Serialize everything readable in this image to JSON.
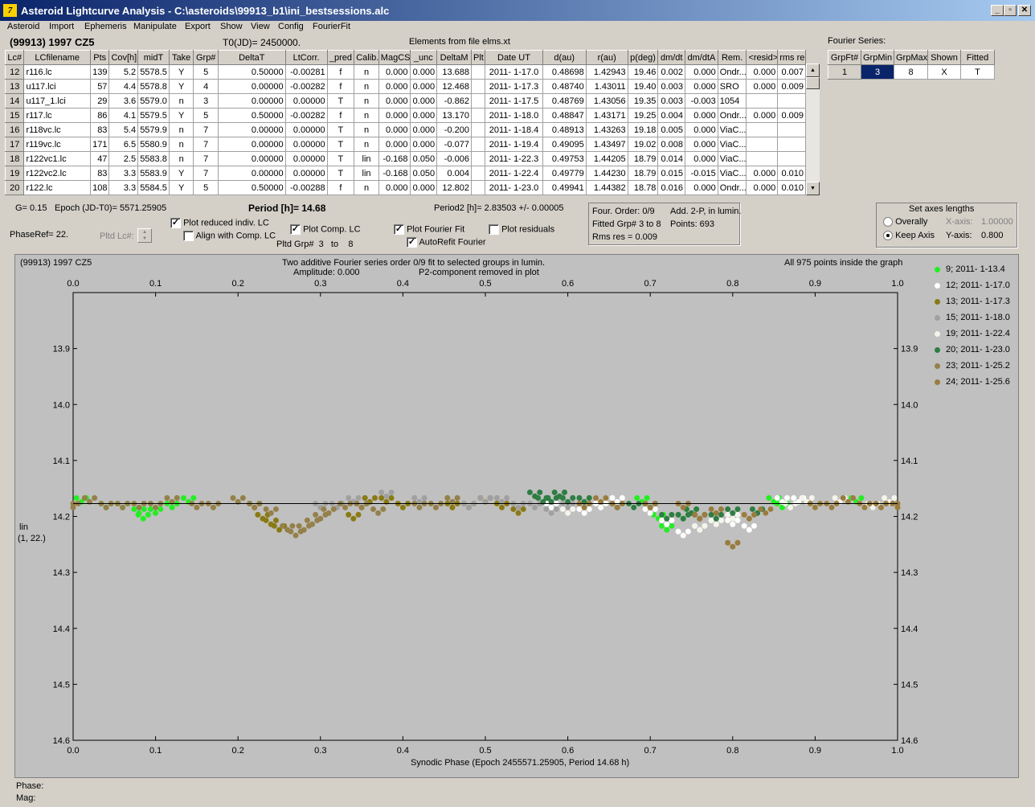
{
  "window": {
    "title": "Asteroid Lightcurve Analysis - C:\\asteroids\\99913_b1\\ini_bestsessions.alc",
    "icon_glyph": "7",
    "min": "_",
    "restore": "▫",
    "close": "✕"
  },
  "menu": [
    "Asteroid",
    "Import",
    "Ephemeris",
    "Manipulate",
    "Export",
    "Show",
    "View",
    "Config",
    "FourierFit"
  ],
  "header": {
    "asteroid": "(99913) 1997 CZ5",
    "t0": "T0(JD)= 2450000.",
    "elements": "Elements from file elms.xt"
  },
  "table": {
    "columns": [
      "Lc#",
      "LCfilename",
      "Pts",
      "Cov[h]",
      "midT",
      "Take",
      "Grp#",
      "DeltaT",
      "LtCorr.",
      "_pred",
      "Calib.",
      "MagCS",
      "_unc",
      "DeltaM",
      "Plt",
      "Date UT",
      "d(au)",
      "r(au)",
      "p(deg)",
      "dm/dt",
      "dm/dtA",
      "Rem.",
      "<resid>",
      "rms res"
    ],
    "rows": [
      [
        "12",
        "r116.lc",
        "139",
        "5.2",
        "5578.5",
        "Y",
        "5",
        "0.50000",
        "-0.00281",
        "f",
        "n",
        "0.000",
        "0.000",
        "13.688",
        "",
        "2011- 1-17.0",
        "0.48698",
        "1.42943",
        "19.46",
        "0.002",
        "0.000",
        "Ondr...",
        "0.000",
        "0.007"
      ],
      [
        "13",
        "u117.lci",
        "57",
        "4.4",
        "5578.8",
        "Y",
        "4",
        "0.00000",
        "-0.00282",
        "f",
        "n",
        "0.000",
        "0.000",
        "12.468",
        "",
        "2011- 1-17.3",
        "0.48740",
        "1.43011",
        "19.40",
        "0.003",
        "0.000",
        "SRO",
        "0.000",
        "0.009"
      ],
      [
        "14",
        "u117_1.lci",
        "29",
        "3.6",
        "5579.0",
        "n",
        "3",
        "0.00000",
        "0.00000",
        "T",
        "n",
        "0.000",
        "0.000",
        "-0.862",
        "",
        "2011- 1-17.5",
        "0.48769",
        "1.43056",
        "19.35",
        "0.003",
        "-0.003",
        "1054",
        "",
        ""
      ],
      [
        "15",
        "r117.lc",
        "86",
        "4.1",
        "5579.5",
        "Y",
        "5",
        "0.50000",
        "-0.00282",
        "f",
        "n",
        "0.000",
        "0.000",
        "13.170",
        "",
        "2011- 1-18.0",
        "0.48847",
        "1.43171",
        "19.25",
        "0.004",
        "0.000",
        "Ondr...",
        "0.000",
        "0.009"
      ],
      [
        "16",
        "r118vc.lc",
        "83",
        "5.4",
        "5579.9",
        "n",
        "7",
        "0.00000",
        "0.00000",
        "T",
        "n",
        "0.000",
        "0.000",
        "-0.200",
        "",
        "2011- 1-18.4",
        "0.48913",
        "1.43263",
        "19.18",
        "0.005",
        "0.000",
        "ViaC...",
        "",
        ""
      ],
      [
        "17",
        "r119vc.lc",
        "171",
        "6.5",
        "5580.9",
        "n",
        "7",
        "0.00000",
        "0.00000",
        "T",
        "n",
        "0.000",
        "0.000",
        "-0.077",
        "",
        "2011- 1-19.4",
        "0.49095",
        "1.43497",
        "19.02",
        "0.008",
        "0.000",
        "ViaC...",
        "",
        ""
      ],
      [
        "18",
        "r122vc1.lc",
        "47",
        "2.5",
        "5583.8",
        "n",
        "7",
        "0.00000",
        "0.00000",
        "T",
        "lin",
        "-0.168",
        "0.050",
        "-0.006",
        "",
        "2011- 1-22.3",
        "0.49753",
        "1.44205",
        "18.79",
        "0.014",
        "0.000",
        "ViaC...",
        "",
        ""
      ],
      [
        "19",
        "r122vc2.lc",
        "83",
        "3.3",
        "5583.9",
        "Y",
        "7",
        "0.00000",
        "0.00000",
        "T",
        "lin",
        "-0.168",
        "0.050",
        "0.004",
        "",
        "2011- 1-22.4",
        "0.49779",
        "1.44230",
        "18.79",
        "0.015",
        "-0.015",
        "ViaC...",
        "0.000",
        "0.010"
      ],
      [
        "20",
        "r122.lc",
        "108",
        "3.3",
        "5584.5",
        "Y",
        "5",
        "0.50000",
        "-0.00288",
        "f",
        "n",
        "0.000",
        "0.000",
        "12.802",
        "",
        "2011- 1-23.0",
        "0.49941",
        "1.44382",
        "18.78",
        "0.016",
        "0.000",
        "Ondr...",
        "0.000",
        "0.010"
      ]
    ]
  },
  "fourier": {
    "label": "Fourier Series:",
    "columns": [
      "GrpFt#",
      "GrpMin",
      "GrpMax",
      "Shown",
      "Fitted"
    ],
    "row": [
      "1",
      "3",
      "8",
      "X",
      "T"
    ]
  },
  "info": {
    "g": "G= 0.15",
    "epoch": "Epoch (JD-T0)= 5571.25905",
    "period": "Period [h]= 14.68",
    "period2": "Period2 [h]= 2.83503 +/- 0.00005",
    "phaseref": "PhaseRef= 22.",
    "pltd_lc": "Pltd Lc#:",
    "pltd_grp": "Pltd Grp#",
    "grp_from": "3",
    "grp_to": "to",
    "grp_to_val": "8"
  },
  "checks": {
    "plot_reduced": {
      "label": "Plot reduced indiv. LC",
      "checked": true
    },
    "align_comp": {
      "label": "Align with Comp. LC",
      "checked": false
    },
    "plot_comp": {
      "label": "Plot Comp. LC",
      "checked": true
    },
    "plot_fourier": {
      "label": "Plot Fourier Fit",
      "checked": true
    },
    "autorefit": {
      "label": "AutoRefit Fourier",
      "checked": true
    },
    "plot_resid": {
      "label": "Plot residuals",
      "checked": false
    }
  },
  "stats": {
    "order": "Four. Order:  0/9",
    "add": "Add. 2-P, in lumin.",
    "fitted": "Fitted Grp# 3 to 8",
    "points": "Points: 693",
    "rms": "Rms res     = 0.009"
  },
  "axes": {
    "title": "Set axes lengths",
    "overally": "Overally",
    "keep": "Keep Axis",
    "xaxis_label": "X-axis:",
    "xaxis_val": "1.00000",
    "yaxis_label": "Y-axis:",
    "yaxis_val": "0.800"
  },
  "plot": {
    "name": "(99913) 1997 CZ5",
    "subtitle1": "Two additive Fourier series order 0/9 fit to selected groups in lumin.",
    "subtitle2": "Amplitude: 0.000",
    "subtitle3": "P2-component removed in plot",
    "count": "All 975 points inside the graph",
    "xlabel": "Synodic Phase (Epoch 2455571.25905, Period 14.68 h)",
    "ylabel1": "lin",
    "ylabel2": "(1, 22.)"
  },
  "status": {
    "phase": "Phase:",
    "mag": "Mag:"
  },
  "colors": {
    "g9": "#22ee22",
    "g12": "#ffffff",
    "g13": "#8a7a14",
    "g15": "#a0a0a0",
    "g19": "#f4f4ec",
    "g20": "#2e7d42",
    "g23": "#94804a",
    "g24": "#9a7c40",
    "fit": "#000000",
    "bg": "#c0c0c0"
  },
  "chart_data": {
    "type": "scatter",
    "xlim": [
      0,
      1
    ],
    "ylim": [
      14.6,
      13.8
    ],
    "y_inverted": true,
    "x_ticks": [
      "0.0",
      "0.1",
      "0.2",
      "0.3",
      "0.4",
      "0.5",
      "0.6",
      "0.7",
      "0.8",
      "0.9",
      "1.0"
    ],
    "y_ticks": [
      "13.9",
      "14.0",
      "14.1",
      "14.2",
      "14.3",
      "14.4",
      "14.5",
      "14.6"
    ],
    "fit_line": {
      "y": 14.177
    },
    "series": [
      {
        "name": "9; 2011- 1-13.4",
        "color": "#22ee22",
        "points": [
          [
            0.01,
            14.17
          ],
          [
            0.04,
            14.18
          ],
          [
            0.06,
            14.18
          ],
          [
            0.08,
            14.19
          ],
          [
            0.085,
            14.2
          ],
          [
            0.1,
            14.19
          ],
          [
            0.12,
            14.18
          ],
          [
            0.14,
            14.17
          ],
          [
            0.69,
            14.17
          ],
          [
            0.7,
            14.18
          ],
          [
            0.71,
            14.2
          ],
          [
            0.72,
            14.22
          ],
          [
            0.74,
            14.2
          ],
          [
            0.75,
            14.19
          ],
          [
            0.85,
            14.17
          ],
          [
            0.86,
            14.18
          ],
          [
            0.88,
            14.17
          ],
          [
            0.9,
            14.18
          ],
          [
            0.95,
            14.17
          ],
          [
            0.97,
            14.18
          ]
        ]
      },
      {
        "name": "12; 2011- 1-17.0",
        "color": "#ffffff",
        "points": [
          [
            0.58,
            14.18
          ],
          [
            0.6,
            14.18
          ],
          [
            0.62,
            14.19
          ],
          [
            0.64,
            14.18
          ],
          [
            0.66,
            14.17
          ],
          [
            0.68,
            14.18
          ],
          [
            0.7,
            14.19
          ],
          [
            0.72,
            14.21
          ],
          [
            0.74,
            14.23
          ],
          [
            0.76,
            14.22
          ],
          [
            0.78,
            14.21
          ],
          [
            0.8,
            14.21
          ],
          [
            0.82,
            14.22
          ],
          [
            0.84,
            14.19
          ],
          [
            0.86,
            14.17
          ],
          [
            0.88,
            14.17
          ],
          [
            0.9,
            14.18
          ],
          [
            0.92,
            14.18
          ],
          [
            0.94,
            14.17
          ],
          [
            0.96,
            14.18
          ]
        ]
      },
      {
        "name": "13; 2011- 1-17.3",
        "color": "#8a7a14",
        "points": [
          [
            0.22,
            14.18
          ],
          [
            0.23,
            14.2
          ],
          [
            0.24,
            14.21
          ],
          [
            0.25,
            14.22
          ],
          [
            0.34,
            14.2
          ],
          [
            0.35,
            14.18
          ],
          [
            0.36,
            14.17
          ],
          [
            0.38,
            14.17
          ],
          [
            0.4,
            14.18
          ],
          [
            0.46,
            14.18
          ],
          [
            0.48,
            14.18
          ],
          [
            0.5,
            14.17
          ],
          [
            0.52,
            14.18
          ],
          [
            0.54,
            14.19
          ]
        ]
      },
      {
        "name": "15; 2011- 1-18.0",
        "color": "#a0a0a0",
        "points": [
          [
            0.3,
            14.18
          ],
          [
            0.32,
            14.18
          ],
          [
            0.34,
            14.17
          ],
          [
            0.38,
            14.16
          ],
          [
            0.42,
            14.17
          ],
          [
            0.44,
            14.18
          ],
          [
            0.46,
            14.17
          ],
          [
            0.48,
            14.18
          ],
          [
            0.5,
            14.17
          ],
          [
            0.52,
            14.17
          ],
          [
            0.54,
            14.18
          ],
          [
            0.56,
            14.18
          ],
          [
            0.58,
            14.19
          ],
          [
            0.6,
            14.18
          ]
        ]
      },
      {
        "name": "19; 2011- 1-22.4",
        "color": "#f4f4ec",
        "points": [
          [
            0.6,
            14.19
          ],
          [
            0.62,
            14.18
          ],
          [
            0.64,
            14.17
          ],
          [
            0.66,
            14.18
          ],
          [
            0.68,
            14.18
          ],
          [
            0.72,
            14.2
          ],
          [
            0.76,
            14.22
          ],
          [
            0.78,
            14.21
          ],
          [
            0.8,
            14.2
          ],
          [
            0.84,
            14.19
          ],
          [
            0.87,
            14.18
          ],
          [
            0.89,
            14.17
          ],
          [
            0.93,
            14.17
          ],
          [
            0.97,
            14.18
          ],
          [
            0.99,
            14.17
          ]
        ]
      },
      {
        "name": "20; 2011- 1-23.0",
        "color": "#2e7d42",
        "points": [
          [
            0.56,
            14.16
          ],
          [
            0.57,
            14.17
          ],
          [
            0.58,
            14.17
          ],
          [
            0.59,
            14.16
          ],
          [
            0.6,
            14.17
          ],
          [
            0.62,
            14.17
          ],
          [
            0.66,
            14.18
          ],
          [
            0.68,
            14.18
          ],
          [
            0.7,
            14.18
          ],
          [
            0.72,
            14.2
          ],
          [
            0.74,
            14.2
          ],
          [
            0.75,
            14.19
          ],
          [
            0.76,
            14.2
          ],
          [
            0.78,
            14.2
          ],
          [
            0.8,
            14.19
          ],
          [
            0.83,
            14.19
          ]
        ]
      },
      {
        "name": "23; 2011- 1-25.2",
        "color": "#94804a",
        "points": [
          [
            0.0,
            14.18
          ],
          [
            0.02,
            14.17
          ],
          [
            0.04,
            14.18
          ],
          [
            0.06,
            14.18
          ],
          [
            0.08,
            14.18
          ],
          [
            0.1,
            14.18
          ],
          [
            0.12,
            14.17
          ],
          [
            0.15,
            14.18
          ],
          [
            0.17,
            14.18
          ],
          [
            0.2,
            14.17
          ],
          [
            0.22,
            14.18
          ],
          [
            0.24,
            14.19
          ],
          [
            0.26,
            14.22
          ],
          [
            0.27,
            14.23
          ],
          [
            0.28,
            14.22
          ],
          [
            0.29,
            14.21
          ],
          [
            0.3,
            14.2
          ],
          [
            0.31,
            14.19
          ],
          [
            0.33,
            14.18
          ],
          [
            0.35,
            14.18
          ],
          [
            0.37,
            14.19
          ],
          [
            0.42,
            14.18
          ],
          [
            0.44,
            14.18
          ],
          [
            0.46,
            14.17
          ]
        ]
      },
      {
        "name": "24; 2011- 1-25.6",
        "color": "#9a7c40",
        "points": [
          [
            0.8,
            14.25
          ],
          [
            0.82,
            14.2
          ],
          [
            0.84,
            14.19
          ],
          [
            0.9,
            14.18
          ],
          [
            0.92,
            14.18
          ],
          [
            0.94,
            14.17
          ],
          [
            0.96,
            14.18
          ],
          [
            0.98,
            14.18
          ],
          [
            1.0,
            14.18
          ],
          [
            0.76,
            14.2
          ],
          [
            0.78,
            14.19
          ],
          [
            0.74,
            14.18
          ],
          [
            0.7,
            14.18
          ],
          [
            0.66,
            14.18
          ],
          [
            0.64,
            14.17
          ],
          [
            0.62,
            14.18
          ]
        ]
      }
    ]
  }
}
